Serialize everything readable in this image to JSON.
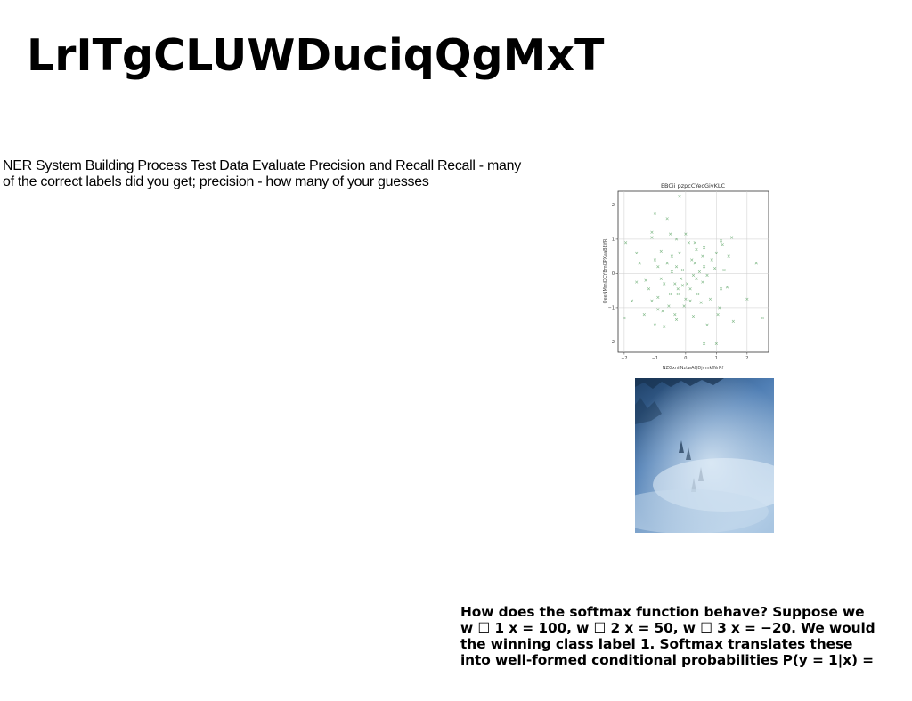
{
  "page": {
    "title": "LrITgCLUWDuciqQgMxT",
    "body_text": "NER System Building Process Test Data Evaluate Precision and Recall Recall - many of the correct labels did you get; precision - how many of your guesses",
    "caption_lines": [
      "How does the softmax function behave? Suppose we",
      "w ☐ 1 x = 100, w ☐ 2 x = 50, w ☐ 3 x = −20. We would",
      "the winning class label 1. Softmax translates these",
      "into well-formed conditional probabilities P(y = 1|x) ="
    ],
    "photo": {
      "subject": "foggy forest aerial",
      "colors": [
        "#1d3f66",
        "#4f7eb4",
        "#a9c6e2"
      ]
    }
  },
  "chart_data": {
    "type": "scatter",
    "title": "EBCii pzpcCYecGiyKLC",
    "xlabel": "NZGxniiNztwAQDjvmkfNrRf",
    "ylabel": "QeeNMmjDCYBmOPXaaBEjfR",
    "xlim": [
      -2.2,
      2.7
    ],
    "ylim": [
      -2.3,
      2.4
    ],
    "xticks": [
      -2,
      -1,
      0,
      1,
      2
    ],
    "yticks": [
      2,
      1,
      0,
      -1,
      -2
    ],
    "tick_labels_x": [
      "−2",
      "−1",
      "0",
      "1",
      "2"
    ],
    "tick_labels_y": [
      "2",
      "1",
      "0",
      "−1",
      "−2"
    ],
    "grid": true,
    "marker": "x",
    "color": "#2e8b3a",
    "points": [
      [
        -0.2,
        2.25
      ],
      [
        -1.0,
        1.75
      ],
      [
        -0.6,
        1.6
      ],
      [
        -1.1,
        1.2
      ],
      [
        -0.5,
        1.15
      ],
      [
        0.0,
        1.15
      ],
      [
        -1.1,
        1.05
      ],
      [
        -0.3,
        1.0
      ],
      [
        0.1,
        0.9
      ],
      [
        0.3,
        0.9
      ],
      [
        1.5,
        1.05
      ],
      [
        1.2,
        0.85
      ],
      [
        -1.95,
        0.9
      ],
      [
        0.6,
        0.75
      ],
      [
        0.35,
        0.7
      ],
      [
        -1.6,
        0.6
      ],
      [
        -0.8,
        0.65
      ],
      [
        -0.45,
        0.5
      ],
      [
        1.0,
        0.6
      ],
      [
        1.4,
        0.5
      ],
      [
        0.55,
        0.5
      ],
      [
        -0.2,
        0.6
      ],
      [
        -1.0,
        0.4
      ],
      [
        0.2,
        0.4
      ],
      [
        0.85,
        0.4
      ],
      [
        -0.6,
        0.3
      ],
      [
        -1.5,
        0.3
      ],
      [
        0.3,
        0.3
      ],
      [
        -0.9,
        0.2
      ],
      [
        -0.3,
        0.2
      ],
      [
        0.6,
        0.2
      ],
      [
        2.3,
        0.3
      ],
      [
        1.25,
        0.1
      ],
      [
        -0.45,
        0.05
      ],
      [
        -0.1,
        0.1
      ],
      [
        0.25,
        -0.05
      ],
      [
        0.7,
        -0.05
      ],
      [
        -1.3,
        -0.2
      ],
      [
        -1.6,
        -0.25
      ],
      [
        0.35,
        -0.15
      ],
      [
        0.55,
        -0.25
      ],
      [
        -0.35,
        -0.3
      ],
      [
        -0.7,
        -0.3
      ],
      [
        -0.1,
        -0.35
      ],
      [
        0.05,
        -0.3
      ],
      [
        0.15,
        -0.45
      ],
      [
        -1.2,
        -0.45
      ],
      [
        -0.25,
        -0.45
      ],
      [
        1.15,
        -0.45
      ],
      [
        1.35,
        -0.4
      ],
      [
        -0.5,
        -0.6
      ],
      [
        0.4,
        -0.6
      ],
      [
        -0.9,
        -0.7
      ],
      [
        0.0,
        -0.75
      ],
      [
        -1.1,
        -0.8
      ],
      [
        -1.75,
        -0.8
      ],
      [
        0.8,
        -0.75
      ],
      [
        -0.05,
        -0.95
      ],
      [
        0.5,
        -0.85
      ],
      [
        -0.55,
        -0.95
      ],
      [
        1.1,
        -1.0
      ],
      [
        -0.75,
        -1.1
      ],
      [
        -0.9,
        -1.05
      ],
      [
        -0.35,
        -1.2
      ],
      [
        1.05,
        -1.2
      ],
      [
        0.25,
        -1.25
      ],
      [
        -1.35,
        -1.2
      ],
      [
        2.0,
        -0.75
      ],
      [
        2.5,
        -1.3
      ],
      [
        -2.0,
        -1.3
      ],
      [
        -1.0,
        -1.5
      ],
      [
        1.55,
        -1.4
      ],
      [
        0.7,
        -1.5
      ],
      [
        -0.7,
        -1.55
      ],
      [
        0.6,
        -2.05
      ],
      [
        1.0,
        -2.05
      ],
      [
        -0.3,
        -1.35
      ],
      [
        0.15,
        -0.8
      ],
      [
        -0.8,
        -0.15
      ],
      [
        0.95,
        0.15
      ],
      [
        -0.15,
        -0.15
      ],
      [
        0.45,
        0.05
      ],
      [
        1.15,
        0.95
      ],
      [
        -0.25,
        -0.6
      ]
    ]
  }
}
